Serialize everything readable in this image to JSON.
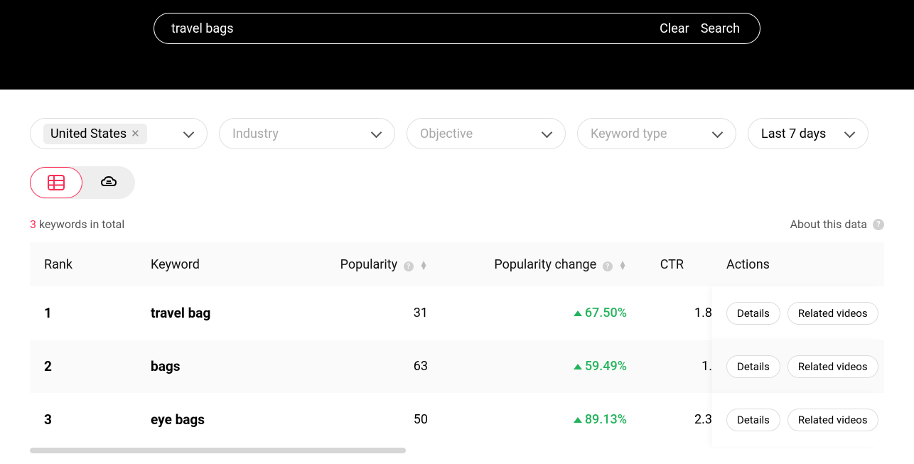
{
  "search": {
    "value": "travel bags",
    "clear_label": "Clear",
    "search_label": "Search"
  },
  "filters": {
    "region": {
      "chip_label": "United States"
    },
    "industry": {
      "label": "Industry"
    },
    "objective": {
      "label": "Objective"
    },
    "keyword_type": {
      "label": "Keyword type"
    },
    "date": {
      "label": "Last 7 days"
    }
  },
  "meta": {
    "count_n": "3",
    "count_text": " keywords in total",
    "about_label": "About this data"
  },
  "table": {
    "headers": {
      "rank": "Rank",
      "keyword": "Keyword",
      "popularity": "Popularity",
      "popularity_change": "Popularity change",
      "ctr": "CTR",
      "actions": "Actions"
    },
    "action_labels": {
      "details": "Details",
      "related_videos": "Related videos"
    },
    "rows": [
      {
        "rank": "1",
        "keyword": "travel bag",
        "popularity": "31",
        "change": "67.50%",
        "ctr": "1.8"
      },
      {
        "rank": "2",
        "keyword": "bags",
        "popularity": "63",
        "change": "59.49%",
        "ctr": "1."
      },
      {
        "rank": "3",
        "keyword": "eye bags",
        "popularity": "50",
        "change": "89.13%",
        "ctr": "2.3"
      }
    ]
  }
}
